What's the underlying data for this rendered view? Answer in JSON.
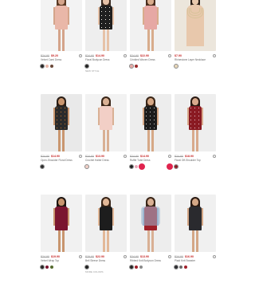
{
  "colors": {
    "sale": "#c62828",
    "badge": "#e0244e"
  },
  "heart_icon": "heart-outline-icon",
  "products": [
    {
      "was": "$24.90",
      "now": "$9.20",
      "name": "Velvet Cami Dress",
      "bg": "#f3f3f3",
      "dress": "#e9b7a8",
      "skin": "#d4a48a",
      "hair": "#5a3a24",
      "swatches": [
        "#222222",
        "#e9b7a8",
        "#6b4a3a"
      ],
      "extra": ""
    },
    {
      "was": "$24.90",
      "now": "$14.90",
      "name": "Floral Bodycon Dress",
      "bg": "#eeeeee",
      "dress": "#1f1f1f",
      "pattern": "#f0ece4",
      "skin": "#e6c2a8",
      "hair": "#3a2a20",
      "swatches": [
        "#1f1f1f"
      ],
      "extra": "NEW STYLE"
    },
    {
      "was": "$24.90",
      "now": "$22.90",
      "name": "Crinkled Woven Dress",
      "bg": "#f1f1f1",
      "dress": "#e6a8a4",
      "skin": "#d8ac8c",
      "hair": "#4a2e1e",
      "swatches": [
        "#e6a8a4",
        "#9b2a2a"
      ],
      "extra": ""
    },
    {
      "was": "",
      "now": "$7.90",
      "name": "Rhinestone Layer Necklace",
      "bg": "#ece6dc",
      "necklace": true,
      "skin": "#e8c8ac",
      "hair": "#2a1e16",
      "swatches": [
        "#e8d6b6"
      ],
      "extra": ""
    },
    {
      "was": "$24.90",
      "now": "$14.90",
      "name": "Open-Shoulder Floral Dress",
      "bg": "#e9e9e9",
      "dress": "#2b2b2b",
      "pattern": "#c9762a",
      "skin": "#c9966f",
      "hair": "#2a1e16",
      "swatches": [
        "#2b2b2b"
      ],
      "extra": ""
    },
    {
      "was": "$24.90",
      "now": "$13.90",
      "name": "Crochet Halter Dress",
      "bg": "#f2f2f2",
      "dress": "#f2cfc6",
      "skin": "#d9b094",
      "hair": "#3a2618",
      "swatches": [
        "#f2cfc6"
      ],
      "extra": ""
    },
    {
      "was": "$24.90",
      "now": "$14.90",
      "name": "Ruffle Tube Dress",
      "bg": "#ededed",
      "dress": "#1c1c1c",
      "pattern": "#d8d8d8",
      "skin": "#d6a886",
      "hair": "#3a2618",
      "swatches": [
        "#1c1c1c",
        "#e8a9b8"
      ],
      "extra": ""
    },
    {
      "was": "$24.90",
      "now": "$18.90",
      "name": "Floral Off-Shoulder Top",
      "bg": "#eeeeee",
      "dress": "#8a1a22",
      "pattern": "#e8c4cc",
      "skin": "#d8aa8c",
      "hair": "#2a1a12",
      "swatches": [
        "#8a1a22"
      ],
      "extra": ""
    },
    {
      "was": "$24.90",
      "now": "$19.90",
      "name": "Velvet Wrap Top",
      "bg": "#f1f1f1",
      "dress": "#7a1530",
      "skin": "#c8956e",
      "hair": "#1e1510",
      "swatches": [
        "#222222",
        "#7a1530",
        "#556b2f"
      ],
      "extra": ""
    },
    {
      "was": "$29.90",
      "now": "$22.90",
      "name": "Bell Sleeve Dress",
      "bg": "#efefef",
      "dress": "#1d1d1d",
      "skin": "#e2b898",
      "hair": "#3a2618",
      "swatches": [
        "#1d1d1d"
      ],
      "extra": "MORE COLORS"
    },
    {
      "was": "$24.90",
      "now": "$13.90",
      "name": "Ribbed Knit Bodycon Dress",
      "bg": "#ededed",
      "dress": "#a0202a",
      "jacket": "#9cb6d0",
      "skin": "#d9b094",
      "hair": "#3a2618",
      "swatches": [
        "#222222",
        "#a0202a",
        "#8a8a8a"
      ],
      "extra": ""
    },
    {
      "was": "$24.90",
      "now": "$16.90",
      "name": "Plaid Knit Sweater",
      "bg": "#f0f0f0",
      "dress": "#2a2a2e",
      "skin": "#d4a786",
      "hair": "#2a1a12",
      "swatches": [
        "#2a2a2e",
        "#6a6a6a",
        "#a0202a"
      ],
      "extra": ""
    }
  ]
}
